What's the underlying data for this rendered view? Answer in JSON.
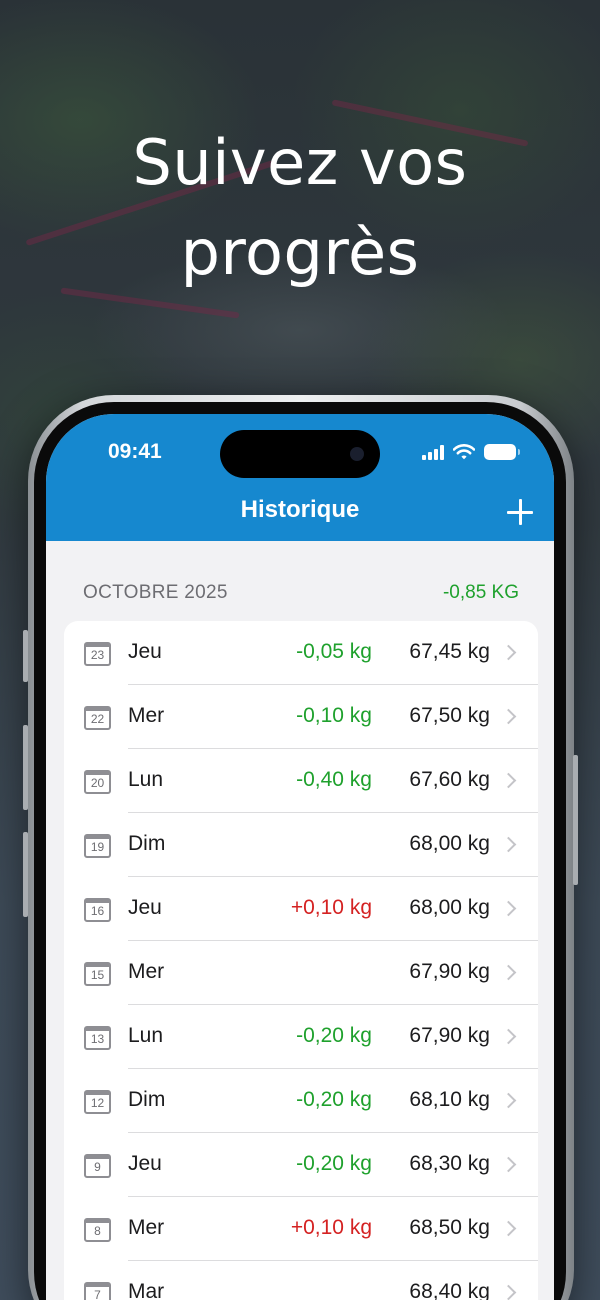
{
  "headline": {
    "line1": "Suivez vos",
    "line2": "progrès"
  },
  "status_bar": {
    "time": "09:41"
  },
  "nav": {
    "title": "Historique",
    "add_icon": "plus-icon"
  },
  "section": {
    "title": "OCTOBRE 2025",
    "total": "-0,85 KG"
  },
  "colors": {
    "nav_bg": "#1688cf",
    "loss": "#1fa12d",
    "gain": "#d42222"
  },
  "entries": [
    {
      "date": "23",
      "day": "Jeu",
      "delta": "-0,05 kg",
      "delta_type": "neg",
      "weight": "67,45 kg"
    },
    {
      "date": "22",
      "day": "Mer",
      "delta": "-0,10 kg",
      "delta_type": "neg",
      "weight": "67,50 kg"
    },
    {
      "date": "20",
      "day": "Lun",
      "delta": "-0,40 kg",
      "delta_type": "neg",
      "weight": "67,60 kg"
    },
    {
      "date": "19",
      "day": "Dim",
      "delta": "",
      "delta_type": "none",
      "weight": "68,00 kg"
    },
    {
      "date": "16",
      "day": "Jeu",
      "delta": "+0,10 kg",
      "delta_type": "pos",
      "weight": "68,00 kg"
    },
    {
      "date": "15",
      "day": "Mer",
      "delta": "",
      "delta_type": "none",
      "weight": "67,90 kg"
    },
    {
      "date": "13",
      "day": "Lun",
      "delta": "-0,20 kg",
      "delta_type": "neg",
      "weight": "67,90 kg"
    },
    {
      "date": "12",
      "day": "Dim",
      "delta": "-0,20 kg",
      "delta_type": "neg",
      "weight": "68,10 kg"
    },
    {
      "date": "9",
      "day": "Jeu",
      "delta": "-0,20 kg",
      "delta_type": "neg",
      "weight": "68,30 kg"
    },
    {
      "date": "8",
      "day": "Mer",
      "delta": "+0,10 kg",
      "delta_type": "pos",
      "weight": "68,50 kg"
    },
    {
      "date": "7",
      "day": "Mar",
      "delta": "",
      "delta_type": "none",
      "weight": "68,40 kg"
    }
  ]
}
